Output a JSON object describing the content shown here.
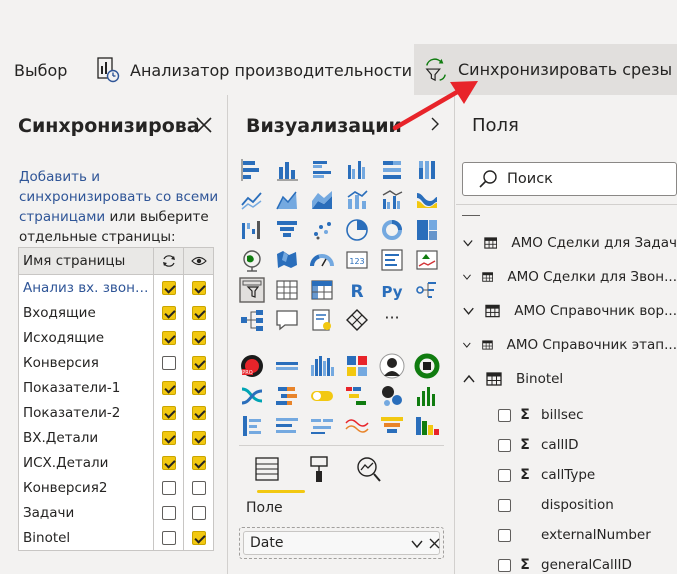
{
  "ribbon": {
    "select_label": "Выбор",
    "perf_label": "Анализатор производительности",
    "sync_label": "Синхронизировать срезы"
  },
  "sync_pane": {
    "title": "Синхронизирова",
    "desc_link": "Добавить и синхронизировать со всеми страницами",
    "desc_rest": " или выберите отдельные страницы:",
    "header": "Имя страницы",
    "rows": [
      {
        "name": "Анализ вх. звонк...",
        "sync": true,
        "visible": true
      },
      {
        "name": "Входящие",
        "sync": true,
        "visible": true
      },
      {
        "name": "Исходящие",
        "sync": true,
        "visible": true
      },
      {
        "name": "Конверсия",
        "sync": false,
        "visible": true
      },
      {
        "name": "Показатели-1",
        "sync": true,
        "visible": true
      },
      {
        "name": "Показатели-2",
        "sync": true,
        "visible": true
      },
      {
        "name": "ВХ.Детали",
        "sync": true,
        "visible": true
      },
      {
        "name": "ИСХ.Детали",
        "sync": true,
        "visible": true
      },
      {
        "name": "Конверсия2",
        "sync": false,
        "visible": false
      },
      {
        "name": "Задачи",
        "sync": false,
        "visible": false
      },
      {
        "name": "Binotel",
        "sync": false,
        "visible": true
      }
    ]
  },
  "viz_pane": {
    "title": "Визуализации",
    "r_label": "R",
    "py_label": "Py",
    "more_label": "···",
    "field_label": "Поле",
    "field_value": "Date"
  },
  "fields_pane": {
    "title": "Поля",
    "search_placeholder": "Поиск",
    "tables": [
      {
        "name": "АМО Сделки для Задач",
        "expanded": false
      },
      {
        "name": "АМО Сделки для Звон...",
        "expanded": false
      },
      {
        "name": "АМО Справочник вор...",
        "expanded": false
      },
      {
        "name": "АМО Справочник этап...",
        "expanded": false
      },
      {
        "name": "Binotel",
        "expanded": true
      }
    ],
    "fields": [
      {
        "name": "billsec",
        "sigma": true
      },
      {
        "name": "callID",
        "sigma": true
      },
      {
        "name": "callType",
        "sigma": true
      },
      {
        "name": "disposition",
        "sigma": false
      },
      {
        "name": "externalNumber",
        "sigma": false
      },
      {
        "name": "generalCallID",
        "sigma": true
      }
    ]
  },
  "colors": {
    "accent_yellow": "#f2c811",
    "arrow_red": "#e8242a",
    "link_blue": "#2f5597"
  }
}
